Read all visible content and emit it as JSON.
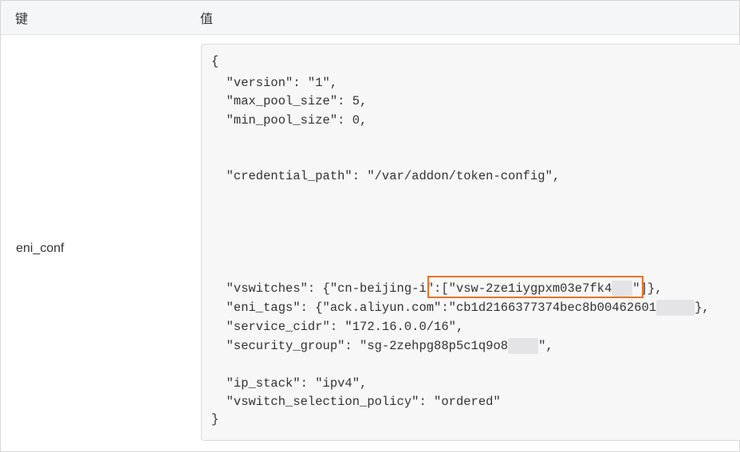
{
  "table": {
    "header_key": "键",
    "header_value": "值",
    "row_key": "eni_conf"
  },
  "code": {
    "lines": [
      "{",
      "  \"version\": \"1\",",
      "  \"max_pool_size\": 5,",
      "  \"min_pool_size\": 0,",
      "  \"credential_path\": \"/var/addon/token-config\",",
      "  \"vswitches\": {\"cn-beijing-i\":[\"vsw-2ze1iygpxm03e7fk4",
      "\"]},",
      "  \"eni_tags\": {\"ack.aliyun.com\":\"cb1d2166377374bec8b00462601",
      "},",
      "  \"service_cidr\": \"172.16.0.0/16\",",
      "  \"security_group\": \"sg-2zehpg88p5c1q9o8",
      "\",",
      "  \"ip_stack\": \"ipv4\",",
      "  \"vswitch_selection_policy\": \"ordered\"",
      "}"
    ]
  },
  "colors": {
    "highlight_border": "#e8732a",
    "header_bg": "#f5f6f8",
    "code_bg": "#f7f7f8"
  }
}
